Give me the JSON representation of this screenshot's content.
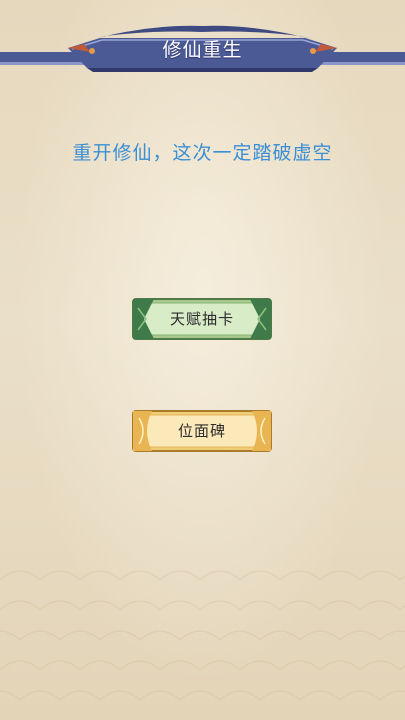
{
  "header": {
    "title": "修仙重生"
  },
  "main": {
    "subtitle": "重开修仙，这次一定踏破虚空",
    "buttons": [
      {
        "label": "天赋抽卡",
        "style": "green"
      },
      {
        "label": "位面碑",
        "style": "gold"
      }
    ]
  },
  "colors": {
    "background": "#e9dcc3",
    "banner": "#4b5a95",
    "subtitle": "#3a8fd6",
    "button_green": "#6fae78",
    "button_gold": "#f3d27e"
  }
}
